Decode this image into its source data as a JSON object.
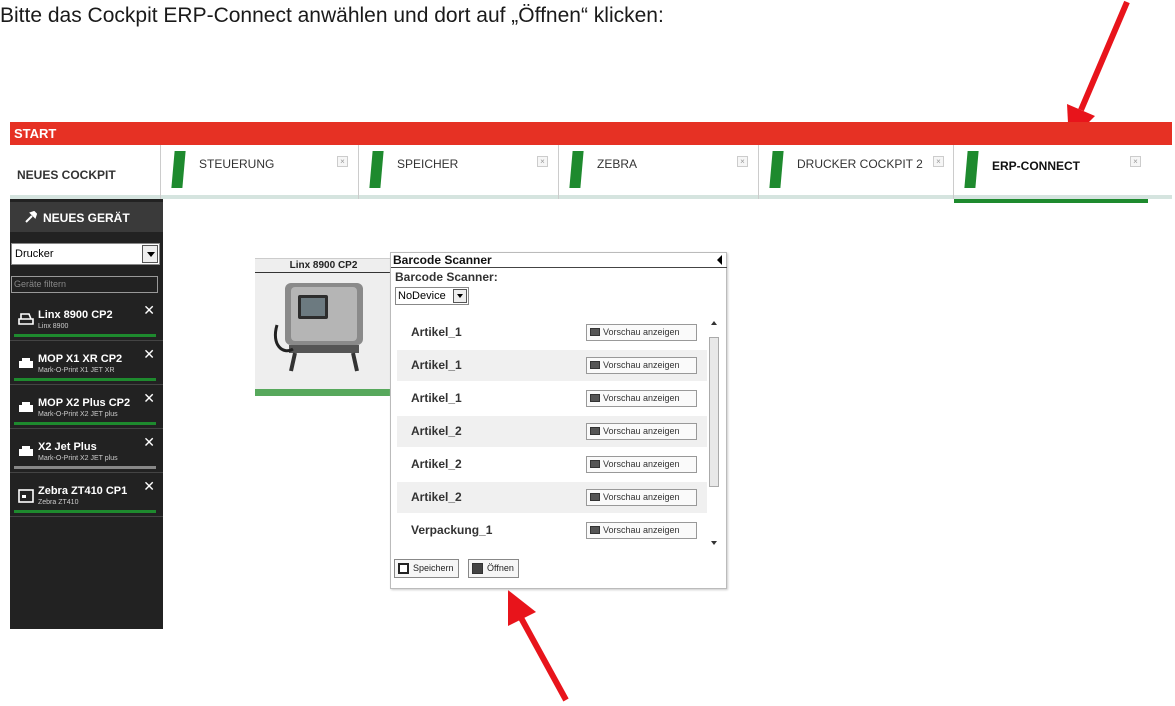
{
  "instruction": "Bitte das Cockpit ERP-Connect anwählen und dort auf „Öffnen“ klicken:",
  "app": {
    "start_label": "START",
    "tabs": [
      {
        "label": "NEUES COCKPIT"
      },
      {
        "label": "STEUERUNG"
      },
      {
        "label": "SPEICHER"
      },
      {
        "label": "ZEBRA"
      },
      {
        "label": "DRUCKER COCKPIT 2"
      },
      {
        "label": "ERP-CONNECT",
        "active": true
      }
    ],
    "tab_close_glyph": "×",
    "sidebar": {
      "title": "NEUES GERÄT",
      "type_select": "Drucker",
      "filter_placeholder": "Geräte filtern",
      "devices": [
        {
          "name": "Linx 8900 CP2",
          "sub": "Linx 8900",
          "icon": "printer-open-icon",
          "status_color": "#1e8a2e"
        },
        {
          "name": "MOP X1 XR CP2",
          "sub": "Mark-O-Print X1 JET XR",
          "icon": "printer-icon",
          "status_color": "#1e8a2e"
        },
        {
          "name": "MOP X2 Plus CP2",
          "sub": "Mark-O-Print X2 JET plus",
          "icon": "printer-icon",
          "status_color": "#1e8a2e"
        },
        {
          "name": "X2 Jet Plus",
          "sub": "Mark-O-Print X2 JET plus",
          "icon": "printer-icon",
          "status_color": "#888888"
        },
        {
          "name": "Zebra ZT410 CP1",
          "sub": "Zebra ZT410",
          "icon": "label-printer-icon",
          "status_color": "#1e8a2e"
        }
      ],
      "remove_glyph": "✕"
    },
    "device_card": {
      "title": "Linx 8900 CP2"
    },
    "panel": {
      "title": "Barcode Scanner",
      "scanner_label": "Barcode Scanner:",
      "scanner_value": "NoDevice",
      "preview_label": "Vorschau anzeigen",
      "rows": [
        "Artikel_1",
        "Artikel_1",
        "Artikel_1",
        "Artikel_2",
        "Artikel_2",
        "Artikel_2",
        "Verpackung_1"
      ],
      "save_label": "Speichern",
      "open_label": "Öffnen"
    }
  },
  "colors": {
    "accent_red": "#e63124",
    "accent_green": "#1e8a2e",
    "arrow": "#e8141b"
  }
}
